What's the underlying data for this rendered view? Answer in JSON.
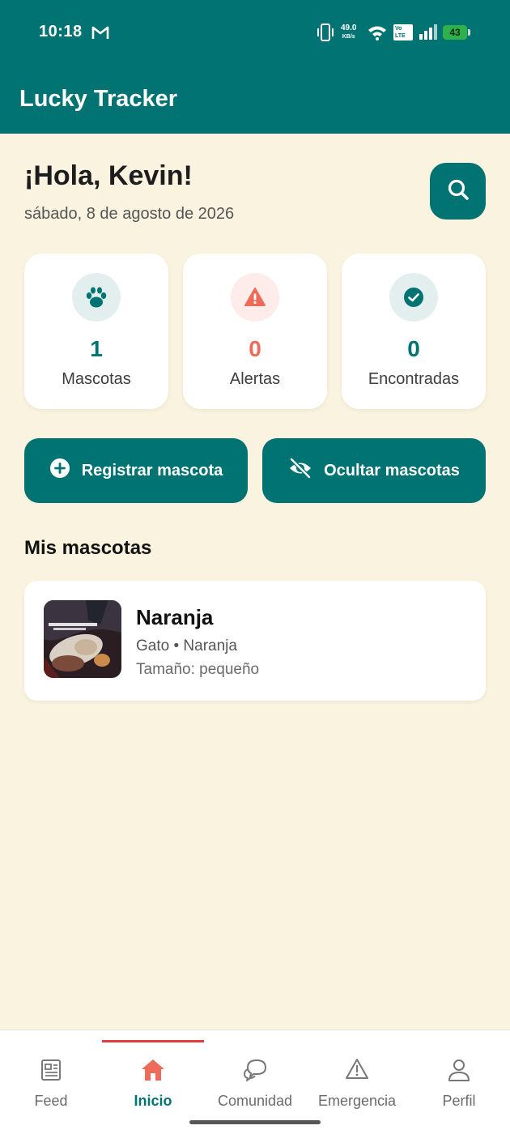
{
  "status_bar": {
    "time": "10:18",
    "speed_value": "49.0",
    "speed_unit": "KB/s",
    "network_top": "Vo",
    "network_bottom": "LTE",
    "battery": "43"
  },
  "app": {
    "title": "Lucky Tracker",
    "brand_color": "#017373",
    "alert_color": "#ee6b5b"
  },
  "header": {
    "greeting": "¡Hola, Kevin!",
    "date": "sábado, 8 de agosto de 2026"
  },
  "stats": [
    {
      "icon": "paw-icon",
      "value": "1",
      "label": "Mascotas"
    },
    {
      "icon": "warning-icon",
      "value": "0",
      "label": "Alertas"
    },
    {
      "icon": "check-circle-icon",
      "value": "0",
      "label": "Encontradas"
    }
  ],
  "actions": {
    "register_label": "Registrar mascota",
    "hide_label": "Ocultar mascotas"
  },
  "pets_section": {
    "title": "Mis mascotas",
    "pets": [
      {
        "name": "Naranja",
        "type_line": "Gato • Naranja",
        "size_line": "Tamaño: pequeño"
      }
    ]
  },
  "bottom_nav": [
    {
      "label": "Feed",
      "icon": "newspaper-icon",
      "active": false
    },
    {
      "label": "Inicio",
      "icon": "home-icon",
      "active": true
    },
    {
      "label": "Comunidad",
      "icon": "chat-bubbles-icon",
      "active": false
    },
    {
      "label": "Emergencia",
      "icon": "warning-icon",
      "active": false
    },
    {
      "label": "Perfil",
      "icon": "user-icon",
      "active": false
    }
  ]
}
